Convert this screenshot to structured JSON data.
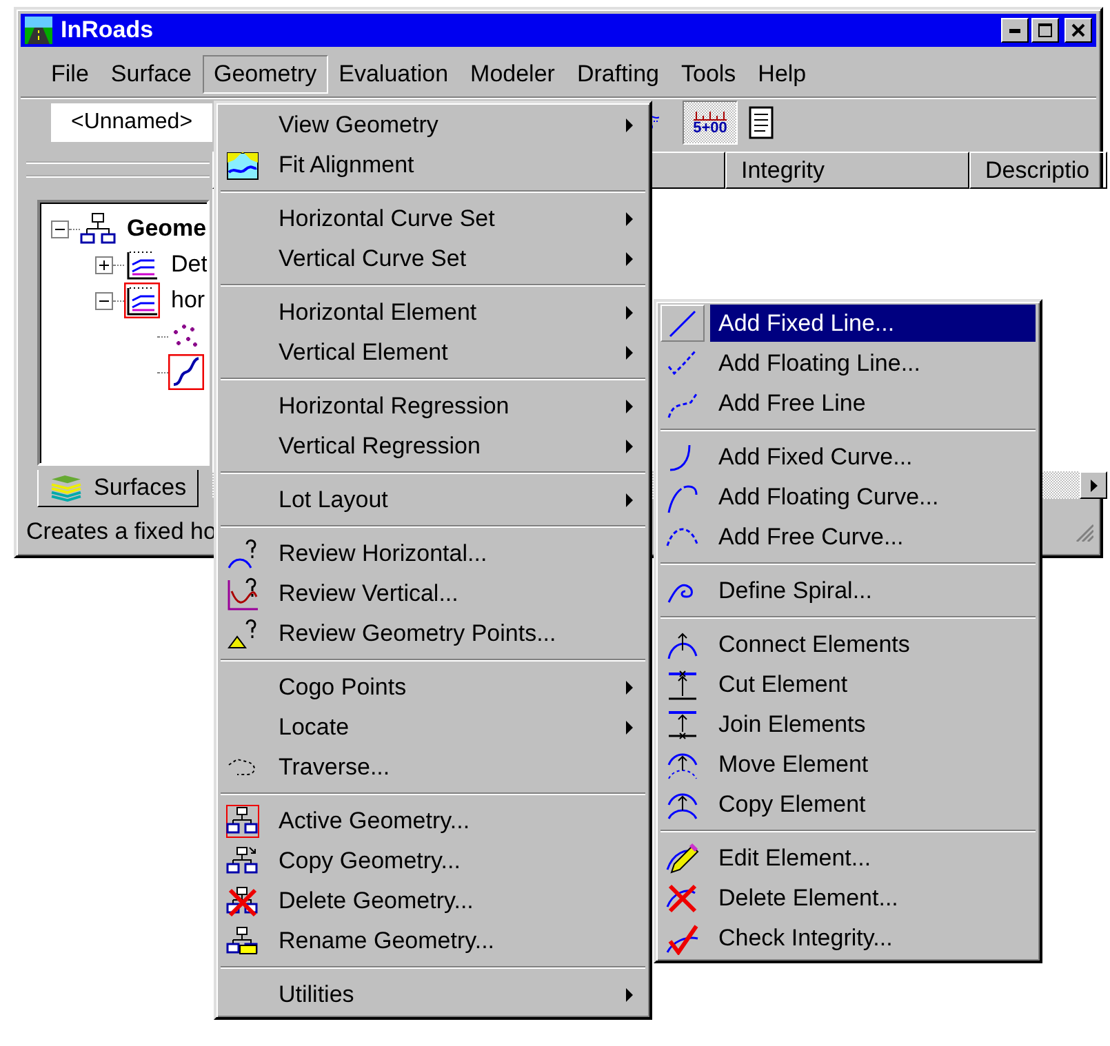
{
  "window": {
    "title": "InRoads"
  },
  "menubar": [
    {
      "label": "File",
      "selected": false
    },
    {
      "label": "Surface",
      "selected": false
    },
    {
      "label": "Geometry",
      "selected": true
    },
    {
      "label": "Evaluation",
      "selected": false
    },
    {
      "label": "Modeler",
      "selected": false
    },
    {
      "label": "Drafting",
      "selected": false
    },
    {
      "label": "Tools",
      "selected": false
    },
    {
      "label": "Help",
      "selected": false
    }
  ],
  "toolbar": {
    "combo_value": "<Unnamed>",
    "station_label": "5+00"
  },
  "tree": {
    "kind": "project",
    "label": "Geome",
    "expanded": true,
    "active": false,
    "children": [
      {
        "kind": "alignment",
        "label": "Det",
        "expanded": false,
        "active": false
      },
      {
        "kind": "alignment",
        "label": "hor",
        "expanded": true,
        "active": true,
        "children": [
          {
            "kind": "points",
            "active": false
          },
          {
            "kind": "curve",
            "active": true
          }
        ]
      }
    ]
  },
  "tabs": [
    {
      "label": "Surfaces",
      "selected": true
    }
  ],
  "list": {
    "columns": [
      "Integrity",
      "Descriptio"
    ]
  },
  "status_bar": "Creates a fixed ho",
  "geometry_menu": [
    {
      "kind": "item",
      "label": "View Geometry",
      "submenu": true
    },
    {
      "kind": "item",
      "label": "Fit Alignment",
      "submenu": false
    },
    {
      "kind": "separator"
    },
    {
      "kind": "item",
      "label": "Horizontal Curve Set",
      "submenu": true
    },
    {
      "kind": "item",
      "label": "Vertical Curve Set",
      "submenu": true
    },
    {
      "kind": "separator"
    },
    {
      "kind": "item",
      "label": "Horizontal Element",
      "submenu": true
    },
    {
      "kind": "item",
      "label": "Vertical Element",
      "submenu": true
    },
    {
      "kind": "separator"
    },
    {
      "kind": "item",
      "label": "Horizontal Regression",
      "submenu": true
    },
    {
      "kind": "item",
      "label": "Vertical Regression",
      "submenu": true
    },
    {
      "kind": "separator"
    },
    {
      "kind": "item",
      "label": "Lot Layout",
      "submenu": true
    },
    {
      "kind": "separator"
    },
    {
      "kind": "item",
      "label": "Review Horizontal...",
      "submenu": false
    },
    {
      "kind": "item",
      "label": "Review Vertical...",
      "submenu": false
    },
    {
      "kind": "item",
      "label": "Review Geometry Points...",
      "submenu": false
    },
    {
      "kind": "separator"
    },
    {
      "kind": "item",
      "label": "Cogo Points",
      "submenu": true
    },
    {
      "kind": "item",
      "label": "Locate",
      "submenu": true
    },
    {
      "kind": "item",
      "label": "Traverse...",
      "submenu": false
    },
    {
      "kind": "separator"
    },
    {
      "kind": "item",
      "label": "Active Geometry...",
      "submenu": false
    },
    {
      "kind": "item",
      "label": "Copy Geometry...",
      "submenu": false
    },
    {
      "kind": "item",
      "label": "Delete Geometry...",
      "submenu": false
    },
    {
      "kind": "item",
      "label": "Rename Geometry...",
      "submenu": false
    },
    {
      "kind": "separator"
    },
    {
      "kind": "item",
      "label": "Utilities",
      "submenu": true
    }
  ],
  "element_menu": [
    {
      "kind": "item",
      "label": "Add Fixed Line...",
      "selected": true
    },
    {
      "kind": "item",
      "label": "Add Floating Line...",
      "selected": false
    },
    {
      "kind": "item",
      "label": "Add Free Line",
      "selected": false
    },
    {
      "kind": "separator"
    },
    {
      "kind": "item",
      "label": "Add Fixed Curve...",
      "selected": false
    },
    {
      "kind": "item",
      "label": "Add Floating Curve...",
      "selected": false
    },
    {
      "kind": "item",
      "label": "Add Free Curve...",
      "selected": false
    },
    {
      "kind": "separator"
    },
    {
      "kind": "item",
      "label": "Define Spiral...",
      "selected": false
    },
    {
      "kind": "separator"
    },
    {
      "kind": "item",
      "label": "Connect Elements",
      "selected": false
    },
    {
      "kind": "item",
      "label": "Cut Element",
      "selected": false
    },
    {
      "kind": "item",
      "label": "Join Elements",
      "selected": false
    },
    {
      "kind": "item",
      "label": "Move Element",
      "selected": false
    },
    {
      "kind": "item",
      "label": "Copy Element",
      "selected": false
    },
    {
      "kind": "separator"
    },
    {
      "kind": "item",
      "label": "Edit Element...",
      "selected": false
    },
    {
      "kind": "item",
      "label": "Delete Element...",
      "selected": false
    },
    {
      "kind": "item",
      "label": "Check Integrity...",
      "selected": false
    }
  ]
}
